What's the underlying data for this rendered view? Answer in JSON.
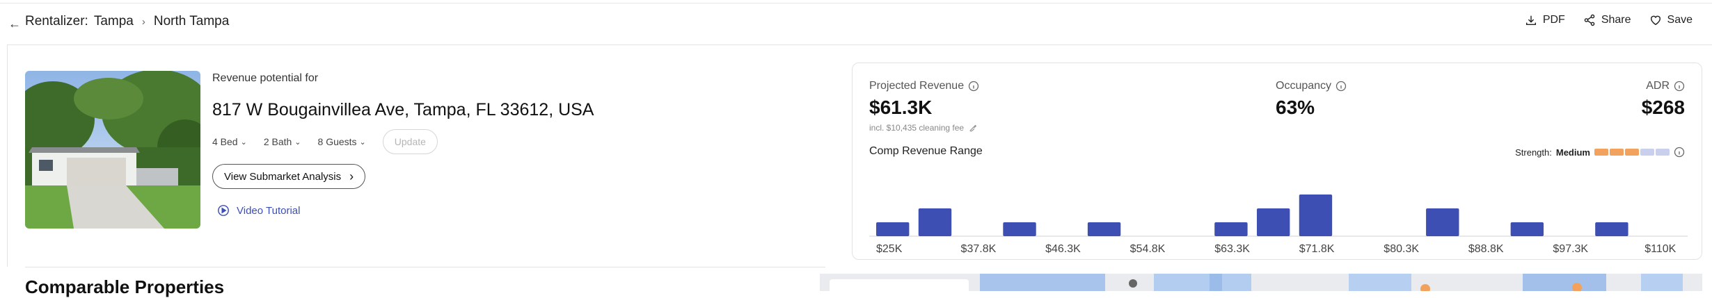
{
  "header": {
    "breadcrumb": {
      "root": "Rentalizer:",
      "city": "Tampa",
      "submarket": "North Tampa"
    },
    "actions": {
      "pdf": "PDF",
      "share": "Share",
      "save": "Save"
    }
  },
  "property": {
    "revenue_potential_label": "Revenue potential for",
    "address": "817 W Bougainvillea Ave, Tampa, FL 33612, USA",
    "bed": "4 Bed",
    "bath": "2 Bath",
    "guests": "8 Guests",
    "update_label": "Update",
    "submarket_button": "View Submarket Analysis",
    "video_tutorial": "Video Tutorial"
  },
  "revenue": {
    "projected_label": "Projected Revenue",
    "projected_value": "$61.3K",
    "cleaning_fee_note": "incl. $10,435 cleaning fee",
    "occupancy_label": "Occupancy",
    "occupancy_value": "63%",
    "adr_label": "ADR",
    "adr_value": "$268",
    "comp_range_label": "Comp Revenue Range",
    "strength_label": "Strength:",
    "strength_value": "Medium",
    "strength_level": 0.5,
    "colors": {
      "bar": "#3d4fb3",
      "strength_fill": "#f2a25c",
      "strength_empty": "#c9d0ee"
    }
  },
  "chart_data": {
    "type": "bar",
    "tick_labels": [
      "$25K",
      "$37.8K",
      "$46.3K",
      "$54.8K",
      "$63.3K",
      "$71.8K",
      "$80.3K",
      "$88.8K",
      "$97.3K",
      "$110K"
    ],
    "bin_count": 19,
    "values": [
      1,
      2,
      0,
      1,
      0,
      1,
      0,
      0,
      1,
      2,
      3,
      0,
      0,
      2,
      0,
      1,
      0,
      1,
      0
    ],
    "ylim": [
      0,
      3
    ]
  },
  "comparables": {
    "title": "Comparable Properties"
  }
}
